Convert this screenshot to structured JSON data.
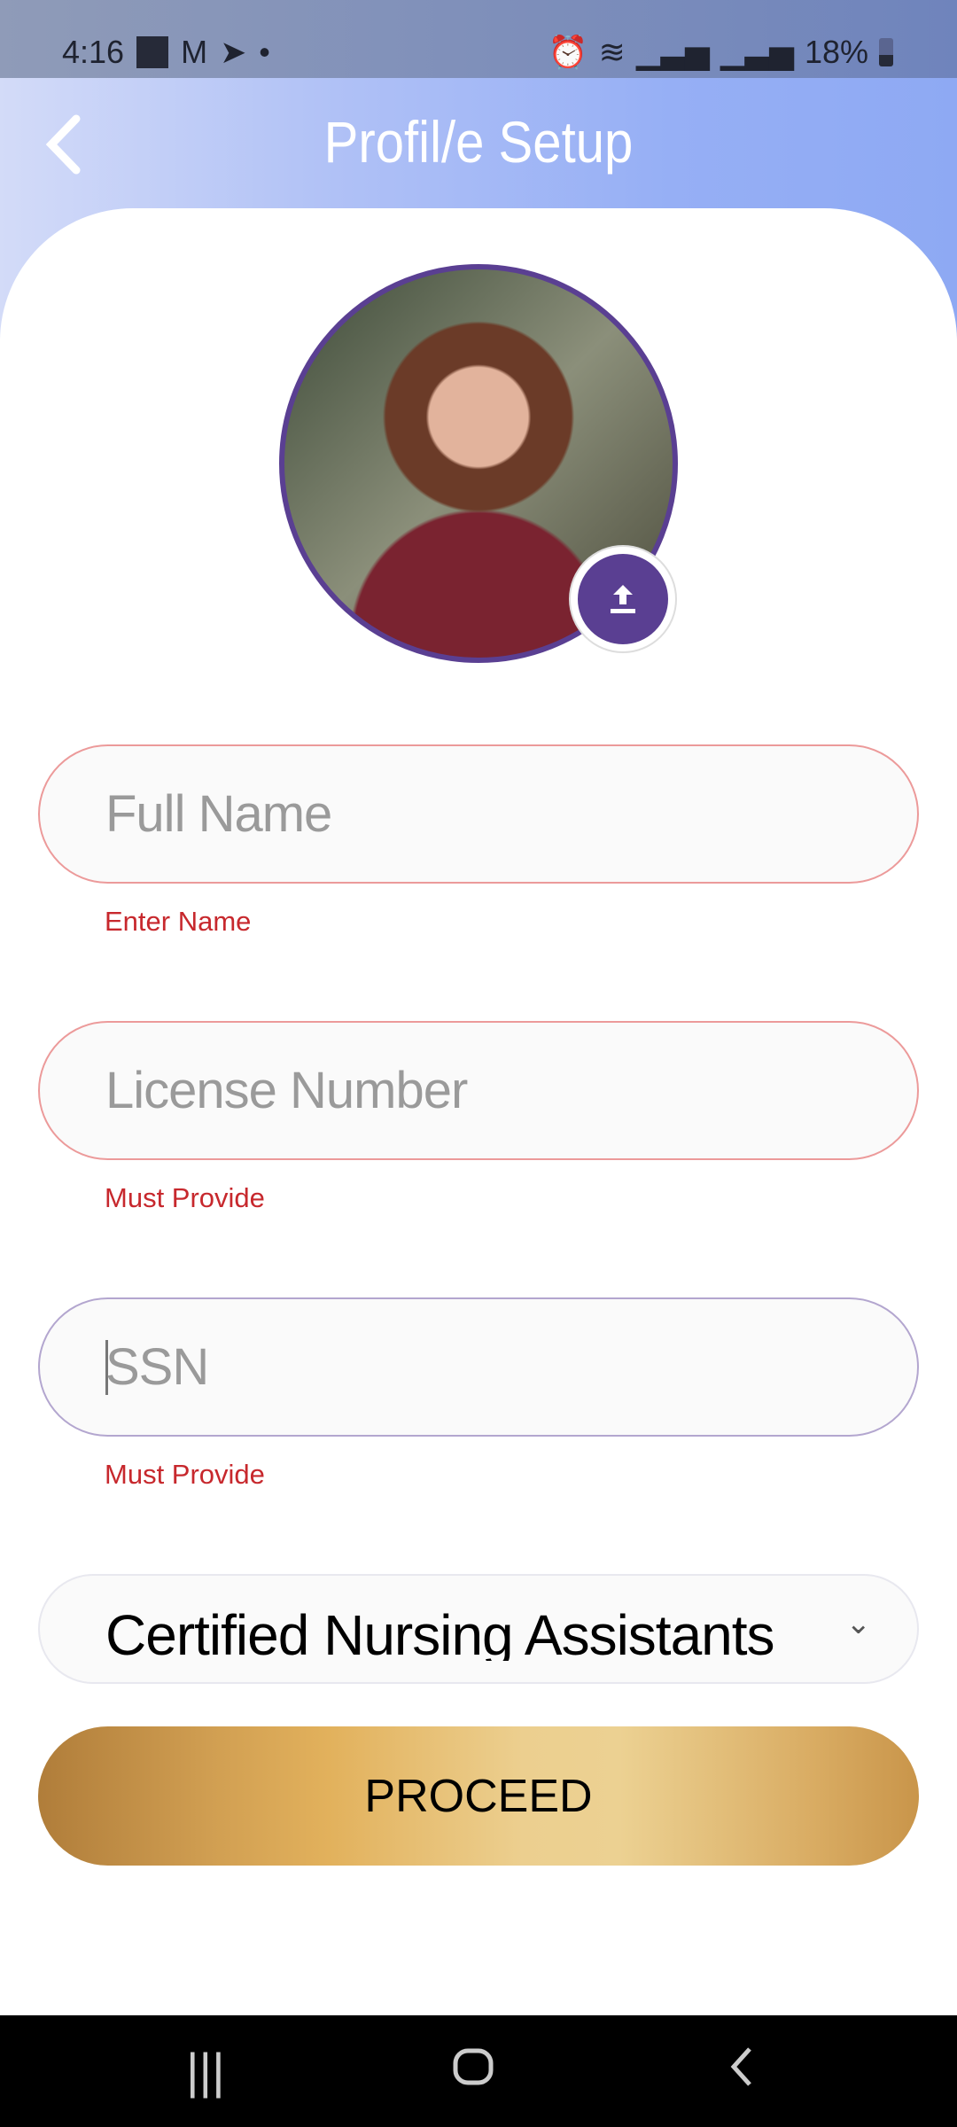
{
  "status_bar": {
    "time": "4:16",
    "battery": "18%",
    "icons": [
      "notification-square-icon",
      "gmail-icon",
      "telegram-icon",
      "dot-icon",
      "alarm-icon",
      "wifi-icon",
      "signal-icon",
      "signal-icon",
      "battery-icon"
    ]
  },
  "header": {
    "title": "Profil/e Setup",
    "back_icon": "chevron-left-icon"
  },
  "profile": {
    "upload_icon": "upload-icon",
    "accent": "#5a3f92"
  },
  "form": {
    "full_name": {
      "placeholder": "Full Name",
      "value": "",
      "error": "Enter Name"
    },
    "license": {
      "placeholder": "License Number",
      "value": "",
      "error": "Must Provide"
    },
    "ssn": {
      "placeholder": "SSN",
      "value": "",
      "error": "Must Provide"
    },
    "role": {
      "selected": "Certified Nursing Assistants"
    },
    "proceed_label": "PROCEED"
  },
  "nav_bar": {
    "icons": [
      "recent-apps-icon",
      "home-icon",
      "back-icon"
    ]
  }
}
